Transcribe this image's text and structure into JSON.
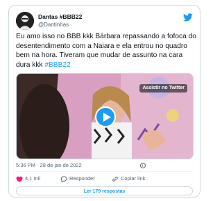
{
  "tweet": {
    "display_name": "Dantas #BBB22",
    "handle": "@Dantinhas",
    "text": "Eu amo isso no BBB kkk Bárbara repassando a fofoca do desentendimento com a Naiara e ela entrou no quadro bem na hora. Tiveram que mudar de assunto na cara dura kkk ",
    "hashtag": "#BBB22",
    "timestamp": "5:36 PM · 28 de jan de 2022",
    "info_glyph": "i"
  },
  "media": {
    "watch_label": "Assistir no Twitter",
    "play_icon": "play-icon"
  },
  "actions": {
    "like_count": "4,1 mil",
    "reply_label": "Responder",
    "copy_label": "Copiar link",
    "read_replies": "Ler 179 respostas"
  },
  "colors": {
    "accent": "#1d9bf0",
    "like": "#f91880",
    "border": "#cfd9de",
    "muted": "#536471"
  }
}
